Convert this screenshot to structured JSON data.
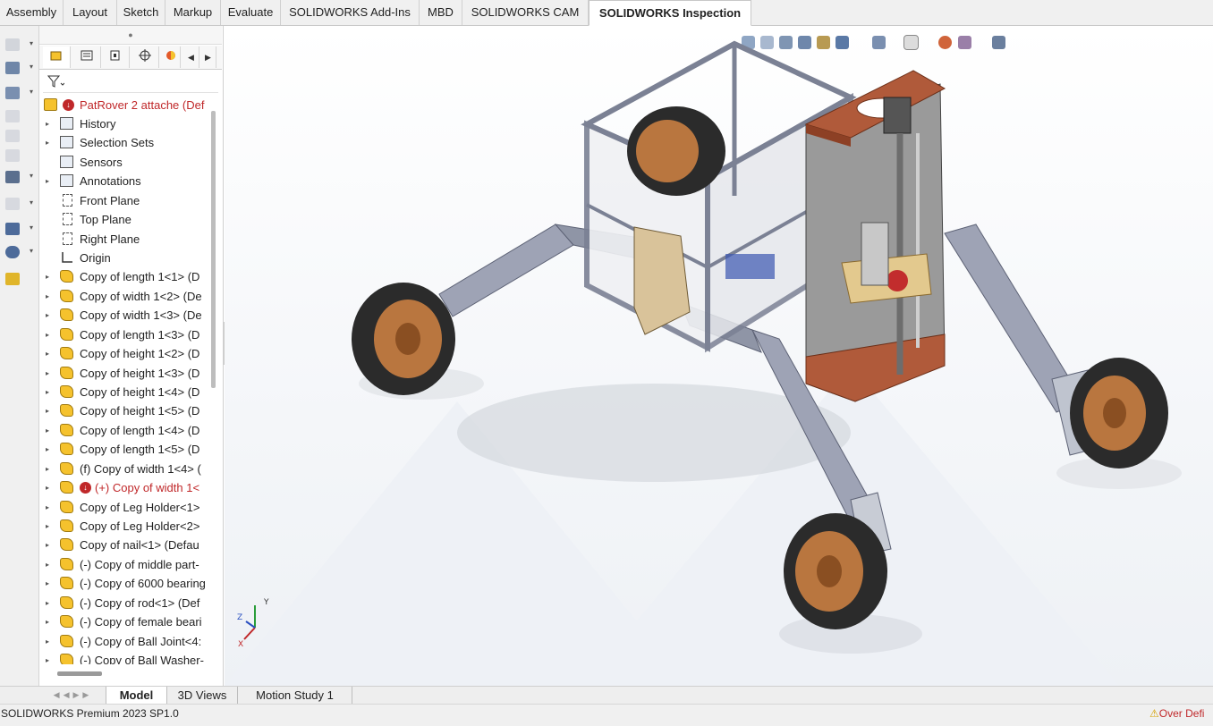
{
  "command_tabs": [
    {
      "label": "Assembly"
    },
    {
      "label": "Layout"
    },
    {
      "label": "Sketch"
    },
    {
      "label": "Markup"
    },
    {
      "label": "Evaluate"
    },
    {
      "label": "SOLIDWORKS Add-Ins"
    },
    {
      "label": "MBD"
    },
    {
      "label": "SOLIDWORKS CAM"
    },
    {
      "label": "SOLIDWORKS Inspection",
      "active": true
    }
  ],
  "feature_tree": {
    "root": "PatRover 2 attache (Def",
    "items": [
      {
        "label": "History",
        "icon": "history-folder-icon",
        "caret": true
      },
      {
        "label": "Selection Sets",
        "icon": "selection-sets-icon",
        "caret": true
      },
      {
        "label": "Sensors",
        "icon": "sensors-folder-icon",
        "caret": false
      },
      {
        "label": "Annotations",
        "icon": "annotations-icon",
        "caret": true
      },
      {
        "label": "Front Plane",
        "icon": "plane-icon",
        "caret": false
      },
      {
        "label": "Top Plane",
        "icon": "plane-icon",
        "caret": false
      },
      {
        "label": "Right Plane",
        "icon": "plane-icon",
        "caret": false
      },
      {
        "label": "Origin",
        "icon": "origin-icon",
        "caret": false
      },
      {
        "label": "Copy of length 1<1> (D",
        "icon": "part-icon",
        "caret": true
      },
      {
        "label": "Copy of width 1<2> (De",
        "icon": "part-icon",
        "caret": true
      },
      {
        "label": "Copy of width 1<3> (De",
        "icon": "part-icon",
        "caret": true
      },
      {
        "label": "Copy of length 1<3> (D",
        "icon": "part-icon",
        "caret": true
      },
      {
        "label": "Copy of height 1<2> (D",
        "icon": "part-icon",
        "caret": true
      },
      {
        "label": "Copy of height 1<3> (D",
        "icon": "part-icon",
        "caret": true
      },
      {
        "label": "Copy of height 1<4> (D",
        "icon": "part-icon",
        "caret": true
      },
      {
        "label": "Copy of height 1<5> (D",
        "icon": "part-icon",
        "caret": true
      },
      {
        "label": "Copy of length 1<4> (D",
        "icon": "part-icon",
        "caret": true
      },
      {
        "label": "Copy of length 1<5> (D",
        "icon": "part-icon",
        "caret": true
      },
      {
        "label": "(f) Copy of width 1<4> (",
        "icon": "part-icon",
        "caret": true
      },
      {
        "label": "(+) Copy of width 1<",
        "icon": "part-icon",
        "caret": true,
        "error": true
      },
      {
        "label": "Copy of Leg Holder<1>",
        "icon": "part-icon",
        "caret": true
      },
      {
        "label": "Copy of Leg Holder<2>",
        "icon": "part-icon",
        "caret": true
      },
      {
        "label": "Copy of nail<1> (Defau",
        "icon": "part-icon",
        "caret": true
      },
      {
        "label": "(-) Copy of middle part-",
        "icon": "part-icon",
        "caret": true
      },
      {
        "label": "(-) Copy of 6000 bearing",
        "icon": "part-icon",
        "caret": true
      },
      {
        "label": "(-) Copy of rod<1> (Def",
        "icon": "part-icon",
        "caret": true
      },
      {
        "label": "(-) Copy of female beari",
        "icon": "part-icon",
        "caret": true
      },
      {
        "label": "(-) Copy of Ball Joint<4:",
        "icon": "part-icon",
        "caret": true
      },
      {
        "label": "(-) Copy of Ball Washer-",
        "icon": "part-icon",
        "caret": true
      }
    ]
  },
  "triad": {
    "x": "X",
    "y": "Y",
    "z": "Z"
  },
  "bottom_tabs": [
    {
      "label": "Model",
      "active": true
    },
    {
      "label": "3D Views"
    },
    {
      "label": "Motion Study 1"
    }
  ],
  "status": {
    "left": "SOLIDWORKS Premium 2023 SP1.0",
    "right": "Over Defi"
  },
  "colors": {
    "frame": "#8f95a6",
    "plate": "#b05a3a",
    "tire": "#2b2b2b",
    "rim": "#b9763f",
    "error": "#c0282a"
  }
}
